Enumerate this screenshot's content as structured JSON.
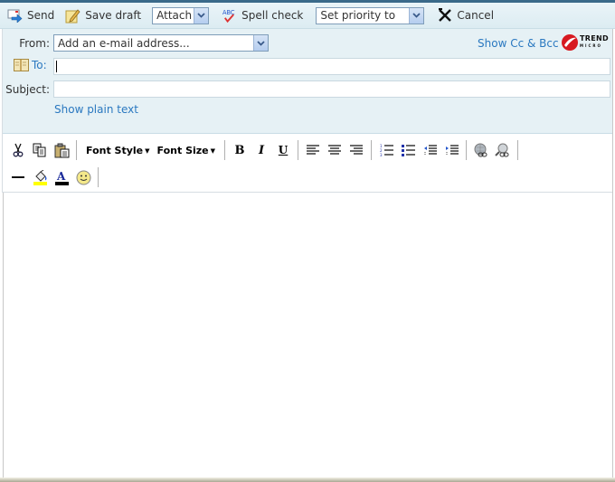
{
  "toolbar": {
    "send_label": "Send",
    "save_draft_label": "Save draft",
    "attach_select": "Attach",
    "spell_check_label": "Spell check",
    "priority_select": "Set priority to",
    "cancel_label": "Cancel",
    "icons": {
      "send": "send-mail-icon",
      "save_draft": "pencil-notepad-icon",
      "spell_check": "abc-check-icon",
      "cancel": "x-icon"
    }
  },
  "header": {
    "from_label": "From:",
    "from_select": "Add an e-mail address...",
    "to_label": "To:",
    "to_value": "",
    "subject_label": "Subject:",
    "subject_value": "",
    "show_cc_bcc": "Show Cc & Bcc",
    "show_plain_text": "Show plain text",
    "logo_text": "TREND",
    "logo_subtext": "MICRO"
  },
  "editor_toolbar": {
    "font_style": "Font Style",
    "font_size": "Font Size",
    "buttons_row1": [
      "cut",
      "copy",
      "paste",
      "bold",
      "italic",
      "underline",
      "align-left",
      "align-center",
      "align-right",
      "numbered-list",
      "bulleted-list",
      "outdent",
      "indent",
      "insert-link",
      "remove-link"
    ],
    "buttons_row2": [
      "horizontal-rule",
      "highlight-color",
      "font-color",
      "emoticon"
    ],
    "highlight_color": "#ffff00",
    "font_color": "#000000"
  },
  "colors": {
    "link": "#2a78c0",
    "header_bg": "#e6f1f5",
    "logo_red": "#d71920"
  }
}
